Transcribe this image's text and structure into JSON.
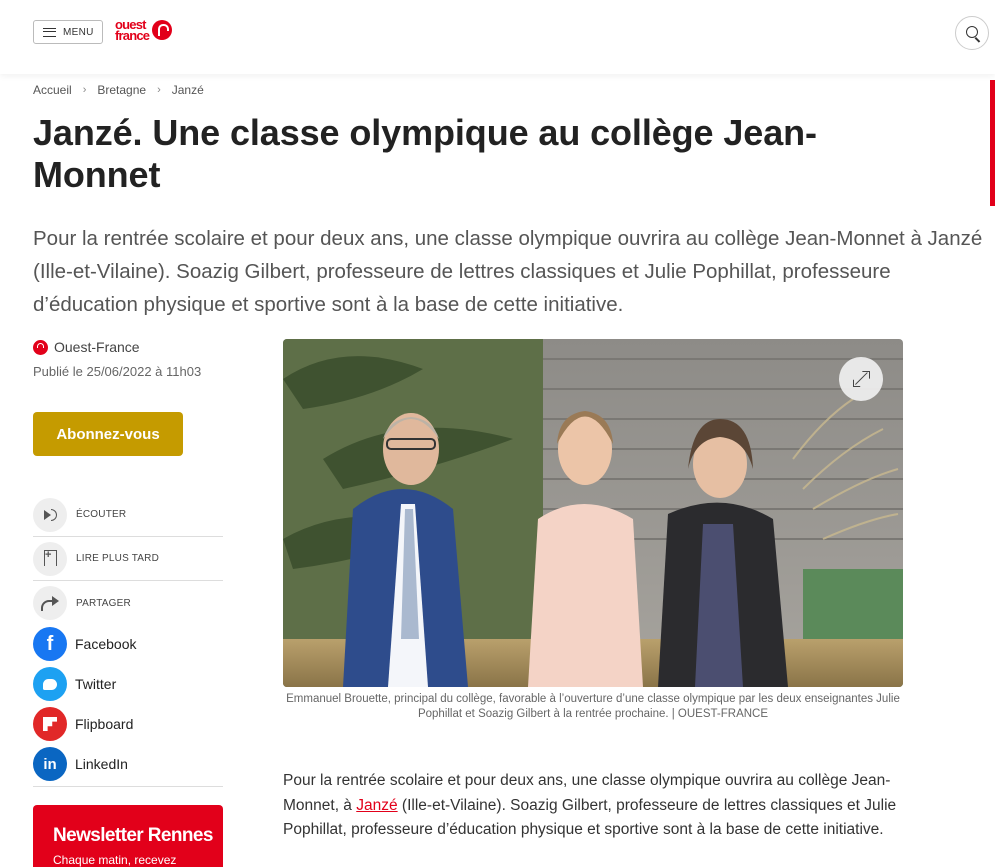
{
  "header": {
    "menu_label": "MENU",
    "logo_line1": "ouest",
    "logo_line2": "france"
  },
  "breadcrumb": [
    "Accueil",
    "Bretagne",
    "Janzé"
  ],
  "article": {
    "title": "Janzé. Une classe olympique au collège Jean-Monnet",
    "lead": "Pour la rentrée scolaire et pour deux ans, une classe olympique ouvrira au collège Jean-Monnet à Janzé (Ille-et-Vilaine). Soazig Gilbert, professeure de lettres classiques et Julie Pophillat, professeure d’éducation physique et sportive sont à la base de cette initiative.",
    "source": "Ouest-France",
    "published": "Publié le 25/06/2022 à 11h03",
    "caption": "Emmanuel Brouette, principal du collège, favorable à l’ouverture d’une classe olympique par les deux enseignantes Julie Pophillat et Soazig Gilbert à la rentrée prochaine. | OUEST-FRANCE",
    "body_before_link": "Pour la rentrée scolaire et pour deux ans, une classe olympique ouvrira au collège Jean-Monnet, à ",
    "body_link": "Janzé",
    "body_after_link": " (Ille-et-Vilaine). Soazig Gilbert, professeure de lettres classiques et Julie Pophillat, professeure d’éducation physique et sportive sont à la base de cette initiative."
  },
  "subscribe_label": "Abonnez-vous",
  "actions": [
    {
      "label": "ÉCOUTER",
      "icon": "audio-icon"
    },
    {
      "label": "LIRE PLUS TARD",
      "icon": "bookmark-add-icon"
    },
    {
      "label": "PARTAGER",
      "icon": "share-icon"
    }
  ],
  "socials": [
    {
      "label": "Facebook",
      "glyph": "f",
      "icon": "facebook-icon",
      "color": "#1877f2"
    },
    {
      "label": "Twitter",
      "glyph": "",
      "icon": "twitter-icon",
      "color": "#1da1f2"
    },
    {
      "label": "Flipboard",
      "glyph": "",
      "icon": "flipboard-icon",
      "color": "#e12828"
    },
    {
      "label": "LinkedIn",
      "glyph": "in",
      "icon": "linkedin-icon",
      "color": "#0a66c2"
    }
  ],
  "newsletter": {
    "title": "Newsletter Rennes",
    "subtitle": "Chaque matin, recevez"
  },
  "colors": {
    "brand_red": "#e2001a",
    "subscribe_gold": "#c59b00"
  }
}
